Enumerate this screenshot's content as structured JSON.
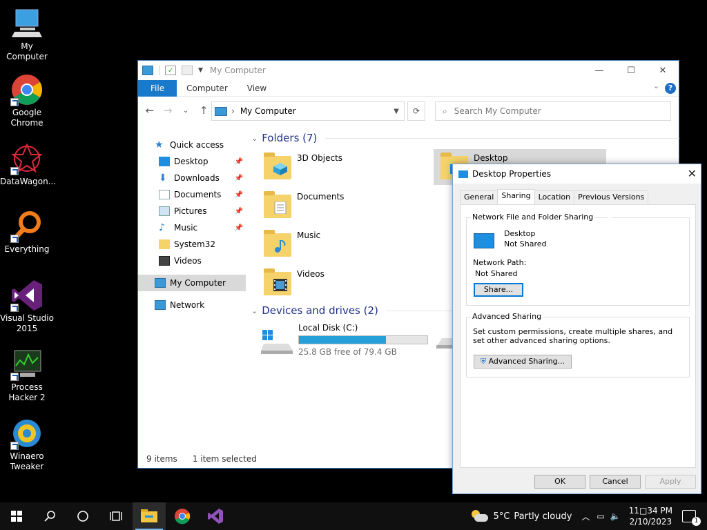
{
  "desktop": {
    "icons": [
      {
        "label": "My Computer"
      },
      {
        "label": "Google Chrome"
      },
      {
        "label": "DataWagon..."
      },
      {
        "label": "Everything"
      },
      {
        "label": "Visual Studio 2015"
      },
      {
        "label": "Process Hacker 2"
      },
      {
        "label": "Winaero Tweaker"
      }
    ]
  },
  "explorer": {
    "title": "My Computer",
    "ribbon_tabs": [
      "File",
      "Computer",
      "View"
    ],
    "help_label": "?",
    "address": "My Computer",
    "address_sep": "›",
    "search_placeholder": "Search My Computer",
    "nav_pane": {
      "quick_access": "Quick access",
      "items": [
        "Desktop",
        "Downloads",
        "Documents",
        "Pictures",
        "Music",
        "System32",
        "Videos"
      ],
      "this_pc": "My Computer",
      "network": "Network"
    },
    "folders_header": "Folders (7)",
    "folders": [
      "3D Objects",
      "Documents",
      "Music",
      "Videos",
      "Desktop"
    ],
    "drives_header": "Devices and drives (2)",
    "drive": {
      "name": "Local Disk (C:)",
      "free": "25.8 GB free of 79.4 GB",
      "used_fraction": 0.675
    },
    "status": {
      "items": "9 items",
      "selected": "1 item selected"
    }
  },
  "properties": {
    "title": "Desktop Properties",
    "tabs": [
      "General",
      "Sharing",
      "Location",
      "Previous Versions"
    ],
    "network_sharing_legend": "Network File and Folder Sharing",
    "folder_name": "Desktop",
    "folder_status": "Not Shared",
    "network_path_label": "Network Path:",
    "network_path_value": "Not Shared",
    "share_button": "Share...",
    "advanced_legend": "Advanced Sharing",
    "advanced_desc": "Set custom permissions, create multiple shares, and set other advanced sharing options.",
    "advanced_button": "Advanced Sharing...",
    "ok": "OK",
    "cancel": "Cancel",
    "apply": "Apply"
  },
  "taskbar": {
    "weather_temp": "5°C",
    "weather_text": "Partly cloudy",
    "time": "11□34 PM",
    "date": "2/10/2023",
    "notification_count": "1"
  },
  "colors": {
    "accent": "#1979ca",
    "selection": "#d9d9d9",
    "group_header": "#1e3287",
    "drive_bar": "#26a0da"
  }
}
